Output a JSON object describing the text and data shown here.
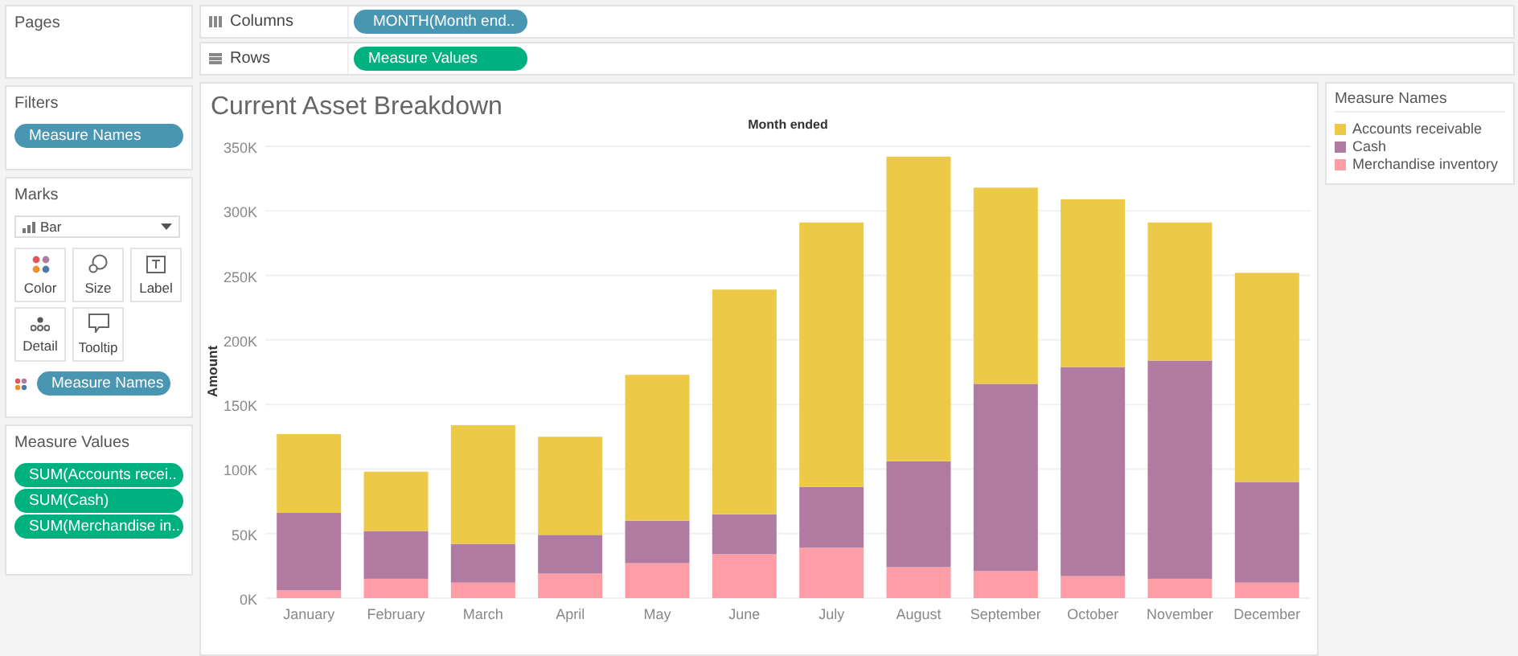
{
  "pages": {
    "title": "Pages"
  },
  "filters": {
    "title": "Filters",
    "pills": [
      "Measure Names"
    ]
  },
  "marks": {
    "title": "Marks",
    "mark_type": "Bar",
    "cards": [
      {
        "label": "Color",
        "kind": "color"
      },
      {
        "label": "Size",
        "kind": "size"
      },
      {
        "label": "Label",
        "kind": "label"
      },
      {
        "label": "Detail",
        "kind": "detail"
      },
      {
        "label": "Tooltip",
        "kind": "tooltip"
      }
    ],
    "color_pill": "Measure Names"
  },
  "measure_values": {
    "title": "Measure Values",
    "pills": [
      "SUM(Accounts recei..",
      "SUM(Cash)",
      "SUM(Merchandise in.."
    ]
  },
  "shelves": [
    {
      "label": "Columns",
      "pill": "MONTH(Month end..",
      "kind": "dimension"
    },
    {
      "label": "Rows",
      "pill": "Measure Values",
      "kind": "measure"
    }
  ],
  "sheet": {
    "title": "Current Asset Breakdown",
    "chart_data": {
      "type": "bar",
      "stacked": true,
      "xlabel": "Month ended",
      "ylabel": "Amount",
      "categories": [
        "January",
        "February",
        "March",
        "April",
        "May",
        "June",
        "July",
        "August",
        "September",
        "October",
        "November",
        "December"
      ],
      "series": [
        {
          "name": "Merchandise inventory",
          "color": "#ff9da7",
          "values": [
            6000,
            15000,
            12000,
            19000,
            27000,
            34000,
            39000,
            24000,
            21000,
            17000,
            15000,
            12000
          ]
        },
        {
          "name": "Cash",
          "color": "#b07aa1",
          "values": [
            60000,
            37000,
            30000,
            30000,
            33000,
            31000,
            47000,
            82000,
            145000,
            162000,
            169000,
            78000
          ]
        },
        {
          "name": "Accounts receivable",
          "color": "#edc948",
          "values": [
            61000,
            46000,
            92000,
            76000,
            113000,
            174000,
            205000,
            236000,
            152000,
            130000,
            107000,
            162000
          ]
        }
      ],
      "ylim": [
        0,
        350000
      ],
      "grid": true,
      "yticks": [
        {
          "value": 0,
          "label": "0K"
        },
        {
          "value": 50000,
          "label": "50K"
        },
        {
          "value": 100000,
          "label": "100K"
        },
        {
          "value": 150000,
          "label": "150K"
        },
        {
          "value": 200000,
          "label": "200K"
        },
        {
          "value": 250000,
          "label": "250K"
        },
        {
          "value": 300000,
          "label": "300K"
        },
        {
          "value": 350000,
          "label": "350K"
        }
      ]
    }
  },
  "legend": {
    "title": "Measure Names"
  }
}
